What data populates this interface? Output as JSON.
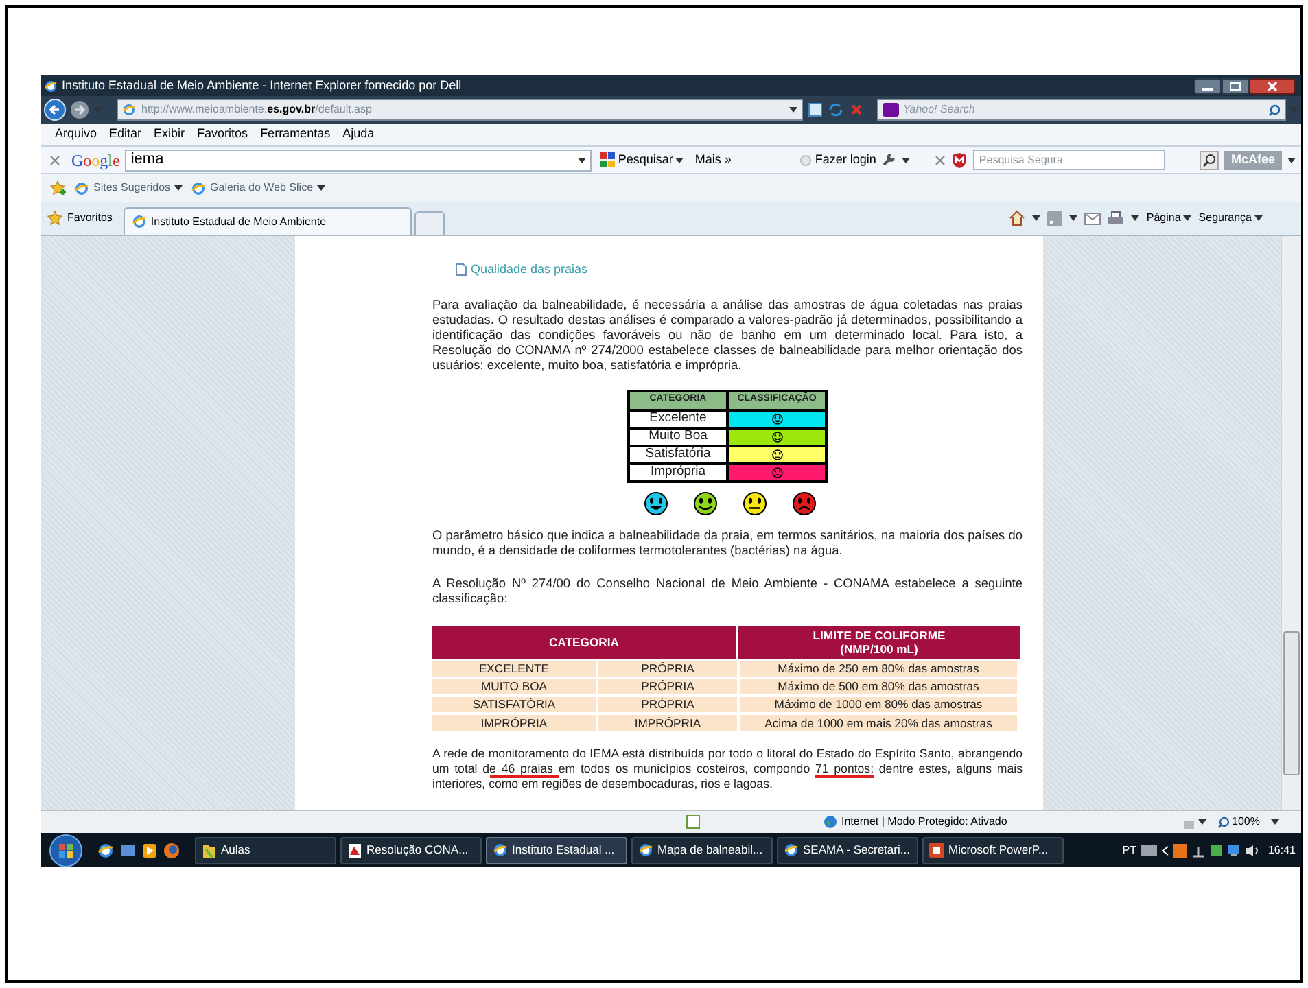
{
  "window": {
    "title": "Instituto Estadual de Meio Ambiente - Internet Explorer fornecido por Dell"
  },
  "address_bar": {
    "url": "http://www.meioambiente.**es.gov.br**/default.asp",
    "search_placeholder": "Yahoo! Search"
  },
  "menu": [
    "Arquivo",
    "Editar",
    "Exibir",
    "Favoritos",
    "Ferramentas",
    "Ajuda"
  ],
  "google_toolbar": {
    "logo": "Google",
    "query": "iema",
    "search_button": "Pesquisar",
    "more_button": "Mais »",
    "login_button": "Fazer login",
    "safe_search_placeholder": "Pesquisa Segura",
    "mcafee_button": "McAfee"
  },
  "links_bar": [
    "Sites Sugeridos",
    "Galeria do Web Slice"
  ],
  "favorites_button": "Favoritos",
  "tabs": [
    {
      "label": "Instituto Estadual de Meio Ambiente",
      "selected": true
    }
  ],
  "command_bar": [
    "Página",
    "Segurança"
  ],
  "page": {
    "link": "Qualidade das praias",
    "intro": "Para avaliação da balneabilidade, é necessária a análise das amostras de água coletadas nas praias estudadas. O resultado destas análises é comparado a valores-padrão já determinados, possibilitando a identificação das condições favoráveis ou não de banho em um determinado local. Para isto, a Resolução do CONAMA nº 274/2000 estabelece classes de balneabilidade para melhor orientação dos usuários: excelente, muito boa, satisfatória e imprópria.",
    "legend_table": {
      "columns": [
        "CATEGORIA",
        "CLASSIFICAÇÃO"
      ],
      "rows": [
        {
          "category": "Excelente",
          "color": "#00e5f0",
          "kind": "grin"
        },
        {
          "category": "Muito Boa",
          "color": "#9be80a",
          "kind": "smile"
        },
        {
          "category": "Satisfatória",
          "color": "#ffff66",
          "kind": "neutral"
        },
        {
          "category": "Imprópria",
          "color": "#ff1a6e",
          "kind": "frown"
        }
      ]
    },
    "faces": [
      {
        "kind": "grin",
        "color": "#22c6e6"
      },
      {
        "kind": "smile",
        "color": "#8fd61a"
      },
      {
        "kind": "neutral",
        "color": "#f5e614"
      },
      {
        "kind": "frown",
        "color": "#e01b1b"
      }
    ],
    "paragraph_2": "O parâmetro básico que indica a balneabilidade da praia, em termos sanitários, na maioria dos países do mundo, é a densidade de coliformes termotolerantes (bactérias) na água.",
    "paragraph_3": "A Resolução Nº 274/00 do Conselho Nacional de Meio Ambiente - CONAMA estabelece a seguinte classificação:",
    "limits_table": {
      "header_groups": [
        "CATEGORIA",
        "LIMITE DE COLIFORME\n(NMP/100 mL)"
      ],
      "rows": [
        [
          "EXCELENTE",
          "PRÓPRIA",
          "Máximo de 250 em 80% das amostras"
        ],
        [
          "MUITO BOA",
          "PRÓPRIA",
          "Máximo de 500 em 80% das amostras"
        ],
        [
          "SATISFATÓRIA",
          "PRÓPRIA",
          "Máximo de 1000 em 80% das amostras"
        ],
        [
          "IMPRÓPRIA",
          "IMPRÓPRIA",
          "Acima de 1000 em mais 20% das amostras"
        ]
      ]
    },
    "paragraph_4": [
      {
        "text": "A rede de monitoramento do IEMA está distribuída por todo o litoral do Estado do Espírito Santo, abrangendo um total d",
        "underlined": false
      },
      {
        "text": "e 46 praias ",
        "underlined": true
      },
      {
        "text": "em todos os municípios costeiros, compondo ",
        "underlined": false
      },
      {
        "text": "71 pontos;",
        "underlined": true
      },
      {
        "text": " dentre estes, alguns mais interiores, como em regiões de desembocaduras, rios e lagoas.",
        "underlined": false
      }
    ]
  },
  "status_bar": {
    "zone": "Internet | Modo Protegido: Ativado",
    "zoom": "100%"
  },
  "taskbar": {
    "items": [
      {
        "label": "Aulas",
        "kind": "folder",
        "selected": false
      },
      {
        "label": "Resolução CONA...",
        "kind": "pdf",
        "selected": false
      },
      {
        "label": "Instituto Estadual ...",
        "kind": "ie",
        "selected": true
      },
      {
        "label": "Mapa de balneabil...",
        "kind": "ie",
        "selected": false
      },
      {
        "label": "SEAMA - Secretari...",
        "kind": "ie",
        "selected": false
      },
      {
        "label": "Microsoft PowerP...",
        "kind": "ppt",
        "selected": false
      }
    ],
    "language": "PT",
    "clock": "16:41"
  }
}
